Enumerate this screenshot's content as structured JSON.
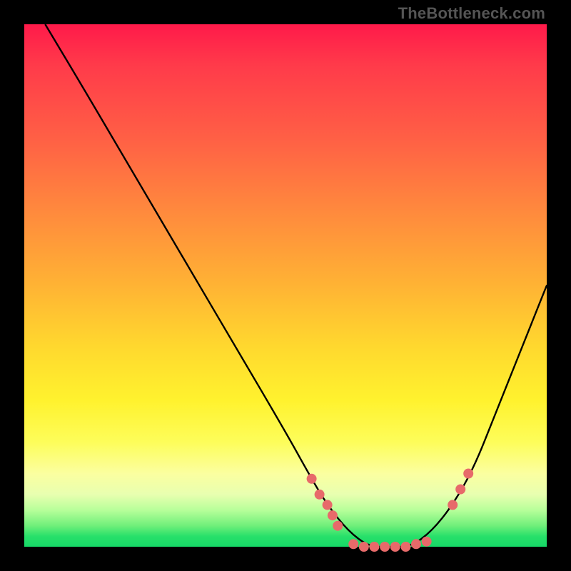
{
  "watermark": "TheBottleneck.com",
  "colors": {
    "curve_stroke": "#000000",
    "marker_fill": "#e76a6a",
    "bg_black": "#000000"
  },
  "chart_data": {
    "type": "line",
    "title": "",
    "xlabel": "",
    "ylabel": "",
    "xlim": [
      0,
      100
    ],
    "ylim": [
      0,
      100
    ],
    "series": [
      {
        "name": "curve",
        "x": [
          4,
          10,
          20,
          30,
          40,
          50,
          55,
          58,
          62,
          66,
          70,
          74,
          78,
          82,
          86,
          90,
          94,
          100
        ],
        "y": [
          100,
          90,
          73,
          56,
          39,
          22,
          13,
          8,
          3,
          0,
          0,
          0,
          3,
          8,
          15,
          25,
          35,
          50
        ]
      }
    ],
    "markers": [
      {
        "x": 55,
        "y": 13
      },
      {
        "x": 56.5,
        "y": 10
      },
      {
        "x": 58,
        "y": 8
      },
      {
        "x": 59,
        "y": 6
      },
      {
        "x": 60,
        "y": 4
      },
      {
        "x": 63,
        "y": 0.5
      },
      {
        "x": 65,
        "y": 0
      },
      {
        "x": 67,
        "y": 0
      },
      {
        "x": 69,
        "y": 0
      },
      {
        "x": 71,
        "y": 0
      },
      {
        "x": 73,
        "y": 0
      },
      {
        "x": 75,
        "y": 0.5
      },
      {
        "x": 77,
        "y": 1
      },
      {
        "x": 82,
        "y": 8
      },
      {
        "x": 83.5,
        "y": 11
      },
      {
        "x": 85,
        "y": 14
      }
    ]
  }
}
